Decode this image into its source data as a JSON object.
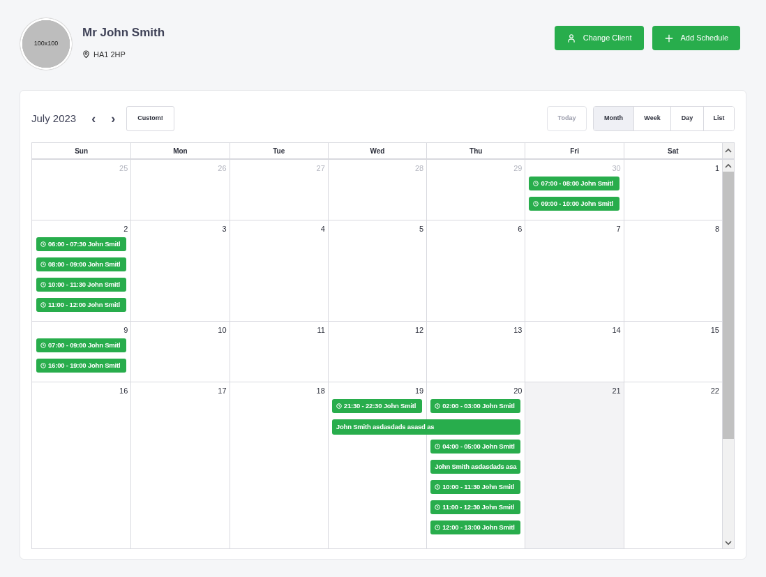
{
  "client": {
    "avatar_label": "100x100",
    "name": "Mr John Smith",
    "postcode": "HA1 2HP"
  },
  "actions": [
    {
      "kind": "user",
      "label": "Change Client"
    },
    {
      "kind": "plus",
      "label": "Add Schedule"
    }
  ],
  "toolbar": {
    "title": "July 2023",
    "prev": "‹",
    "next": "›",
    "custom": "Custom!",
    "today": {
      "label": "Today",
      "disabled": true
    },
    "views": [
      {
        "label": "Month",
        "selected": true
      },
      {
        "label": "Week",
        "selected": false
      },
      {
        "label": "Day",
        "selected": false
      },
      {
        "label": "List",
        "selected": false
      }
    ]
  },
  "weekdays": [
    "Sun",
    "Mon",
    "Tue",
    "Wed",
    "Thu",
    "Fri",
    "Sat"
  ],
  "weeks": [
    {
      "days": [
        {
          "number": "25",
          "other_month": true,
          "today": false
        },
        {
          "number": "26",
          "other_month": true,
          "today": false
        },
        {
          "number": "27",
          "other_month": true,
          "today": false
        },
        {
          "number": "28",
          "other_month": true,
          "today": false
        },
        {
          "number": "29",
          "other_month": true,
          "today": false
        },
        {
          "number": "30",
          "other_month": true,
          "today": false,
          "events": [
            {
              "time": "07:00 - 08:00",
              "title": "John Smitl",
              "multi_day": false
            },
            {
              "time": "09:00 - 10:00",
              "title": "John Smitl",
              "multi_day": false
            }
          ]
        },
        {
          "number": "1",
          "other_month": false,
          "today": false
        }
      ]
    },
    {
      "days": [
        {
          "number": "2",
          "other_month": false,
          "today": false,
          "events": [
            {
              "time": "06:00 - 07:30",
              "title": "John Smitl",
              "multi_day": false
            },
            {
              "time": "08:00 - 09:00",
              "title": "John Smitl",
              "multi_day": false
            },
            {
              "time": "10:00 - 11:30",
              "title": "John Smitl",
              "multi_day": false
            },
            {
              "time": "11:00 - 12:00",
              "title": "John Smitl",
              "multi_day": false
            }
          ]
        },
        {
          "number": "3",
          "other_month": false,
          "today": false
        },
        {
          "number": "4",
          "other_month": false,
          "today": false
        },
        {
          "number": "5",
          "other_month": false,
          "today": false
        },
        {
          "number": "6",
          "other_month": false,
          "today": false
        },
        {
          "number": "7",
          "other_month": false,
          "today": false
        },
        {
          "number": "8",
          "other_month": false,
          "today": false
        }
      ]
    },
    {
      "days": [
        {
          "number": "9",
          "other_month": false,
          "today": false,
          "events": [
            {
              "time": "07:00 - 09:00",
              "title": "John Smitl",
              "multi_day": false
            },
            {
              "time": "16:00 - 19:00",
              "title": "John Smitl",
              "multi_day": false
            }
          ]
        },
        {
          "number": "10",
          "other_month": false,
          "today": false
        },
        {
          "number": "11",
          "other_month": false,
          "today": false
        },
        {
          "number": "12",
          "other_month": false,
          "today": false
        },
        {
          "number": "13",
          "other_month": false,
          "today": false
        },
        {
          "number": "14",
          "other_month": false,
          "today": false
        },
        {
          "number": "15",
          "other_month": false,
          "today": false
        }
      ]
    },
    {
      "days": [
        {
          "number": "16",
          "other_month": false,
          "today": false
        },
        {
          "number": "17",
          "other_month": false,
          "today": false
        },
        {
          "number": "18",
          "other_month": false,
          "today": false
        },
        {
          "number": "19",
          "other_month": false,
          "today": false,
          "events": [
            {
              "time": "21:30 - 22:30",
              "title": "John Smitl",
              "multi_day": false
            },
            {
              "title": "John Smith asdasdads asasd as",
              "multi_day": true
            }
          ]
        },
        {
          "number": "20",
          "other_month": false,
          "today": false,
          "events": [
            {
              "time": "02:00 - 03:00",
              "title": "John Smitl",
              "multi_day": false
            },
            {
              "time": "04:00 - 05:00",
              "title": "John Smitl",
              "multi_day": false
            },
            {
              "title": "John Smith asdasdads asa",
              "multi_day": false
            },
            {
              "time": "10:00 - 11:30",
              "title": "John Smitl",
              "multi_day": false
            },
            {
              "time": "11:00 - 12:30",
              "title": "John Smitl",
              "multi_day": false
            },
            {
              "time": "12:00 - 13:00",
              "title": "John Smitl",
              "multi_day": false
            }
          ]
        },
        {
          "number": "21",
          "other_month": false,
          "today": true
        },
        {
          "number": "22",
          "other_month": false,
          "today": false
        }
      ]
    }
  ]
}
